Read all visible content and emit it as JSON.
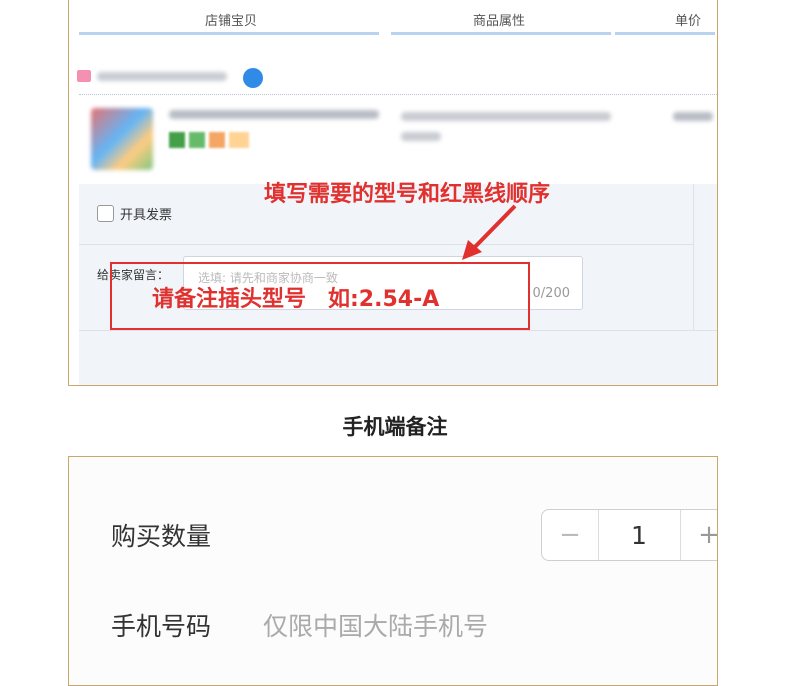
{
  "table_header": {
    "col_item": "店铺宝贝",
    "col_props": "商品属性",
    "col_price": "单价"
  },
  "invoice": {
    "label": "开具发票",
    "checked": false
  },
  "message": {
    "label": "给卖家留言：",
    "placeholder": "选填: 请先和商家协商一致",
    "counter": "0/200"
  },
  "annotations": {
    "top_note": "填写需要的型号和红黑线顺序",
    "box_note": "请备注插头型号　如:2.54-A",
    "color": "#e0312e"
  },
  "section_title": "手机端备注",
  "mobile": {
    "quantity_label": "购买数量",
    "quantity_value": "1",
    "minus_symbol": "−",
    "plus_symbol": "+",
    "phone_label": "手机号码",
    "phone_placeholder": "仅限中国大陆手机号"
  },
  "colors": {
    "panel_border": "#c9a76a",
    "header_underline": "#b9d2f0",
    "form_background": "#f1f5fa"
  }
}
